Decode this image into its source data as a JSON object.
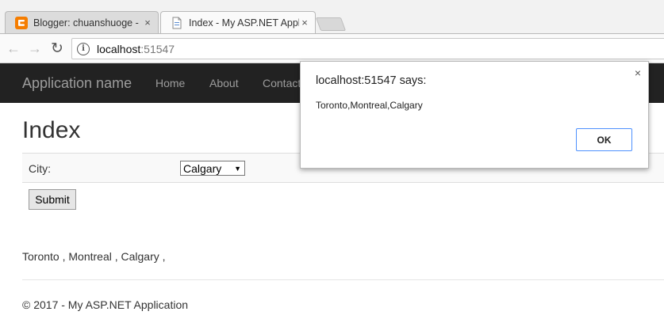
{
  "browser": {
    "tabs": [
      {
        "title": "Blogger: chuanshuoge - (",
        "close": "×"
      },
      {
        "title": "Index - My ASP.NET Appl",
        "close": "×"
      }
    ],
    "nav": {
      "back": "←",
      "forward": "→",
      "reload": "↻"
    },
    "address": {
      "host": "localhost",
      "port": ":51547",
      "info_glyph": "i"
    }
  },
  "site": {
    "brand": "Application name",
    "nav": [
      "Home",
      "About",
      "Contact"
    ]
  },
  "page": {
    "heading": "Index",
    "city_label": "City:",
    "city_selected": "Calgary",
    "select_arrow": "▼",
    "submit_label": "Submit",
    "cities_output": "Toronto , Montreal , Calgary ,",
    "footer": "© 2017 - My ASP.NET Application"
  },
  "dialog": {
    "title": "localhost:51547 says:",
    "close": "×",
    "message": "Toronto,Montreal,Calgary",
    "ok_label": "OK"
  },
  "colors": {
    "navbar_bg": "#222222",
    "nav_text": "#9d9d9d",
    "ok_border": "#4d90fe"
  }
}
